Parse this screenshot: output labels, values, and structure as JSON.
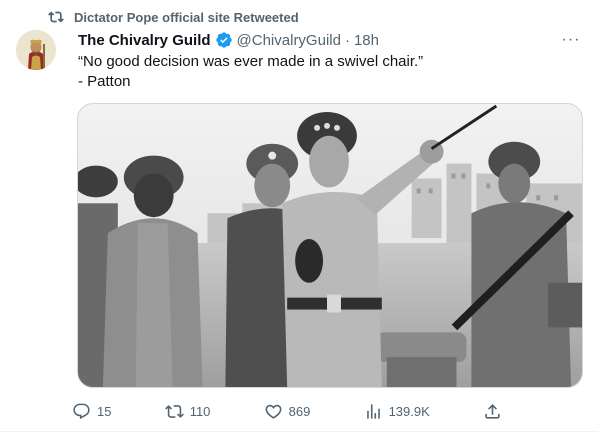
{
  "retweet": {
    "label": "Dictator Pope official site Retweeted",
    "icon": "retweet-icon"
  },
  "author": {
    "display_name": "The Chivalry Guild",
    "handle": "@ChivalryGuild",
    "separator": "·",
    "time": "18h",
    "verified": true,
    "verified_color": "#1d9bf0"
  },
  "tweet": {
    "line1": "“No good decision was ever made in a swivel chair.”",
    "line2": "- Patton"
  },
  "more_label": "···",
  "actions": {
    "replies": "15",
    "retweets": "110",
    "likes": "869",
    "views": "139.9K"
  },
  "colors": {
    "muted": "#536471",
    "text": "#0f1419",
    "accent": "#1d9bf0",
    "border": "#cfd9de"
  }
}
